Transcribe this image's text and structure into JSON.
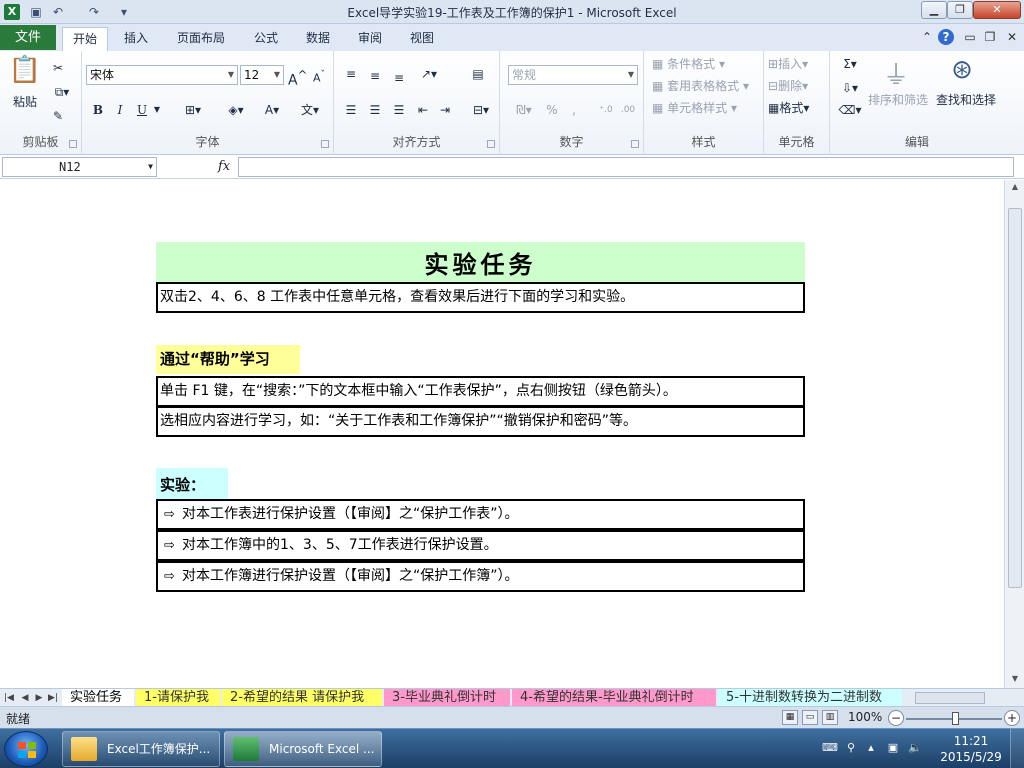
{
  "window": {
    "title": "Excel导学实验19-工作表及工作簿的保护1  -  Microsoft Excel",
    "app_icon": "X"
  },
  "ribbon_tabs": {
    "file": "文件",
    "tabs": [
      "开始",
      "插入",
      "页面布局",
      "公式",
      "数据",
      "审阅",
      "视图"
    ],
    "active": "开始"
  },
  "ribbon": {
    "clipboard": {
      "label": "剪贴板",
      "paste": "粘贴"
    },
    "font": {
      "label": "字体",
      "font_name": "宋体",
      "font_size": "12",
      "bold": "B",
      "italic": "I",
      "underline": "U"
    },
    "alignment": {
      "label": "对齐方式"
    },
    "number": {
      "label": "数字",
      "format": "常规",
      "percent": "%",
      "comma": ","
    },
    "styles": {
      "label": "样式",
      "conditional": "条件格式",
      "table": "套用表格格式",
      "cell_styles": "单元格样式"
    },
    "cells": {
      "label": "单元格",
      "insert": "插入",
      "delete": "删除",
      "format": "格式"
    },
    "editing": {
      "label": "编辑",
      "sum": "Σ",
      "sort_filter": "排序和筛选",
      "find_select": "查找和选择"
    }
  },
  "formula_bar": {
    "name_box": "N12",
    "fx": "fx",
    "value": ""
  },
  "sheet": {
    "title": "实验任务",
    "intro": "双击2、4、6、8 工作表中任意单元格，查看效果后进行下面的学习和实验。",
    "help_heading": "通过“帮助”学习",
    "help_lines": [
      "单击 F1 键，在“搜索：”下的文本框中输入“工作表保护”，点右侧按钮（绿色箭头）。",
      "选相应内容进行学习，如：“关于工作表和工作簿保护”“撤销保护和密码”等。"
    ],
    "exp_heading": "实验：",
    "exp_marker": "⇨",
    "exp_lines": [
      "对本工作表进行保护设置（【审阅】之“保护工作表”）。",
      "对本工作簿中的1、3、5、7工作表进行保护设置。",
      "对本工作簿进行保护设置（【审阅】之“保护工作簿”）。"
    ]
  },
  "sheet_tabs": [
    {
      "label": "实验任务",
      "color": "#ffffff",
      "active": true
    },
    {
      "label": "1-请保护我",
      "color": "#ffff66",
      "active": false
    },
    {
      "label": "2-希望的结果 请保护我",
      "color": "#ffff66",
      "active": false
    },
    {
      "label": "3-毕业典礼倒计时",
      "color": "#ff99cc",
      "active": false
    },
    {
      "label": "4-希望的结果-毕业典礼倒计时",
      "color": "#ff99cc",
      "active": false
    },
    {
      "label": "5-十进制数转换为二进制数",
      "color": "#ccffff",
      "active": false
    }
  ],
  "status_bar": {
    "ready": "就绪",
    "zoom": "100%"
  },
  "taskbar": {
    "items": [
      {
        "label": "Excel工作簿保护...",
        "icon": "folder-icon"
      },
      {
        "label": "Microsoft Excel ...",
        "icon": "excel-icon"
      }
    ],
    "time": "11:21",
    "date": "2015/5/29"
  }
}
